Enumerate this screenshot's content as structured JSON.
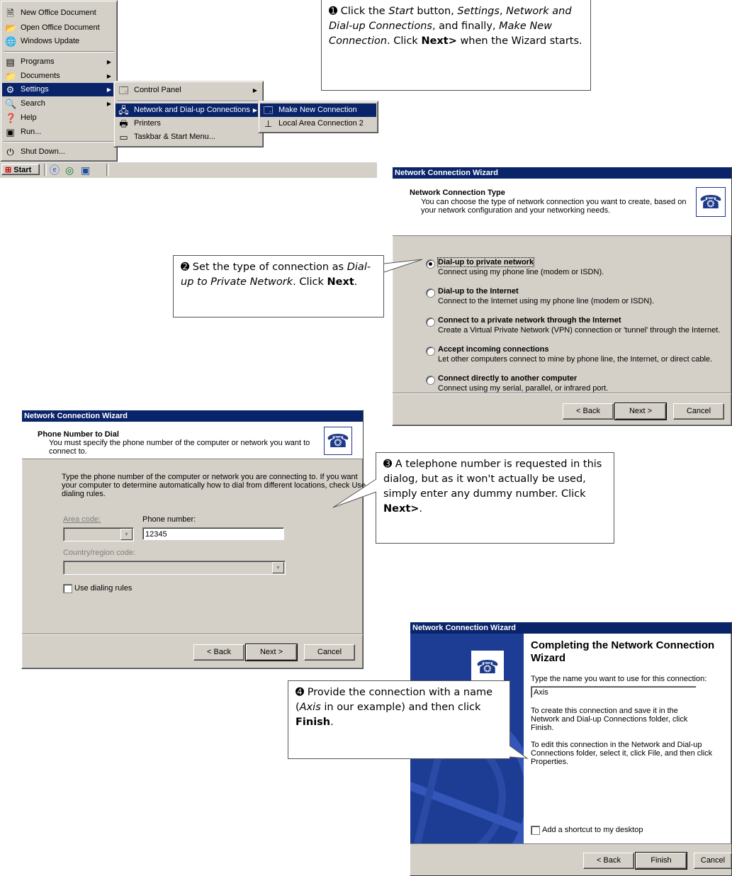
{
  "start_menu": {
    "items": [
      {
        "label": "New Office Document",
        "icon": "office-doc-icon"
      },
      {
        "label": "Open Office Document",
        "icon": "open-folder-icon"
      },
      {
        "label": "Windows Update",
        "icon": "windows-update-icon"
      },
      {
        "label": "Programs",
        "icon": "programs-icon"
      },
      {
        "label": "Documents",
        "icon": "documents-icon"
      },
      {
        "label": "Settings",
        "icon": "settings-icon"
      },
      {
        "label": "Search",
        "icon": "search-icon"
      },
      {
        "label": "Help",
        "icon": "help-icon"
      },
      {
        "label": "Run...",
        "icon": "run-icon"
      },
      {
        "label": "Shut Down...",
        "icon": "shutdown-icon"
      }
    ],
    "settings_submenu": [
      "Control Panel",
      "Network and Dial-up Connections",
      "Printers",
      "Taskbar & Start Menu..."
    ],
    "network_submenu": [
      "Make New Connection",
      "Local Area Connection 2"
    ],
    "start_button": "Start"
  },
  "callout1": {
    "num": "➊",
    "t1": " Click the ",
    "start": "Start",
    "t2": " button, ",
    "settings": "Settings",
    "t3": ", ",
    "network": "Network and Dial-up Connections",
    "t4": ", and finally, ",
    "make": "Make New Connection",
    "t5": ". Click ",
    "next": "Next>",
    "t6": " when the Wizard starts."
  },
  "callout2": {
    "num": "➋",
    "t1": " Set the type of connection as ",
    "dialup": "Dial-up to Private Network",
    "t2": ". Click ",
    "next": "Next",
    "t3": "."
  },
  "callout3": {
    "num": "➌",
    "t1": " A telephone number is requested in this dialog, but as it won't actually be used, simply enter any dummy number. Click ",
    "next": "Next>",
    "t2": "."
  },
  "callout4": {
    "num": "➍",
    "t1": " Provide the connection with a name (",
    "axis": "Axis",
    "t2": " in our example) and then click ",
    "finish": "Finish",
    "t3": "."
  },
  "wizard1": {
    "title": "Network Connection Wizard",
    "header_title": "Network Connection Type",
    "header_desc1": "You can choose the type of network connection you want to create, based on",
    "header_desc2": "your network configuration and your networking needs.",
    "options": [
      {
        "title": "Dial-up to private network",
        "desc": "Connect using my phone line (modem or ISDN).",
        "selected": true
      },
      {
        "title": "Dial-up to the Internet",
        "desc": "Connect to the Internet using my phone line (modem or ISDN).",
        "selected": false
      },
      {
        "title": "Connect to a private network through the Internet",
        "desc": "Create a Virtual Private Network (VPN) connection or 'tunnel' through the Internet.",
        "selected": false
      },
      {
        "title": "Accept incoming connections",
        "desc": "Let other computers connect to mine by phone line, the Internet, or direct cable.",
        "selected": false
      },
      {
        "title": "Connect directly to another computer",
        "desc": "Connect using my serial, parallel, or infrared port.",
        "selected": false
      }
    ],
    "back": "< Back",
    "next": "Next >",
    "cancel": "Cancel"
  },
  "wizard2": {
    "title": "Network Connection Wizard",
    "header_title": "Phone Number to Dial",
    "header_desc1": "You must specify the phone number of the computer or network you want to",
    "header_desc2": "connect to.",
    "body1": "Type the phone number of the computer or network you are connecting to. If you want",
    "body2": "your computer to determine automatically how to dial from different locations, check Use",
    "body3": "dialing rules.",
    "area_code_label": "Area code:",
    "phone_label": "Phone number:",
    "phone_value": "12345",
    "country_label": "Country/region code:",
    "use_dialing": "Use dialing rules",
    "back": "< Back",
    "next": "Next >",
    "cancel": "Cancel"
  },
  "wizard3": {
    "title": "Network Connection Wizard",
    "heading1": "Completing the Network Connection",
    "heading2": "Wizard",
    "name_label": "Type the name you want to use for this connection:",
    "name_value": "Axis",
    "p1a": "To create this connection and save it in the",
    "p1b": "Network and Dial-up Connections folder, click",
    "p1c": "Finish.",
    "p2a": "To edit this connection in the Network and Dial-up",
    "p2b": "Connections folder, select it, click File, and then click",
    "p2c": "Properties.",
    "shortcut": "Add a shortcut to my desktop",
    "back": "< Back",
    "finish": "Finish",
    "cancel": "Cancel"
  }
}
